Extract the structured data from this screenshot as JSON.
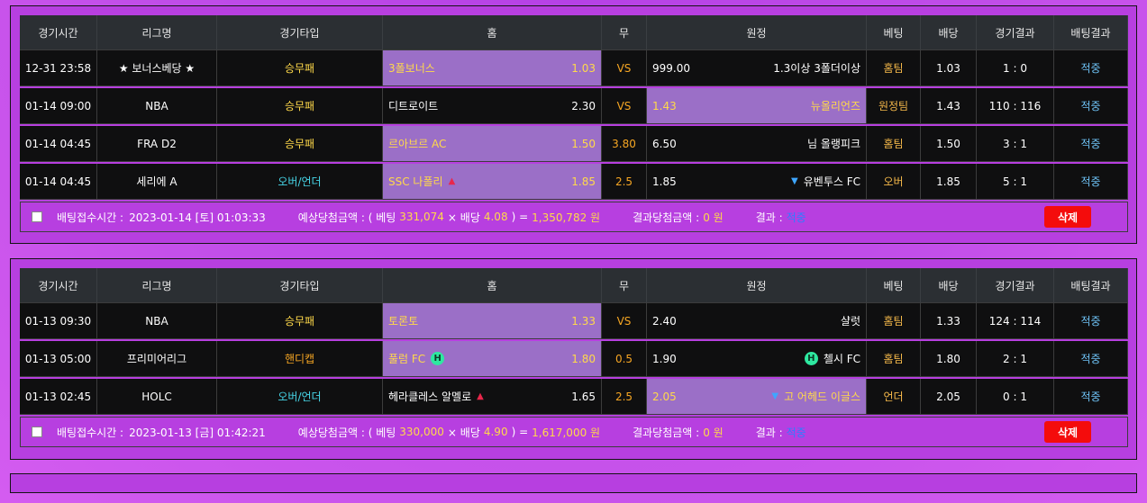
{
  "headers": [
    "경기시간",
    "리그명",
    "경기타입",
    "홈",
    "무",
    "원정",
    "베팅",
    "배당",
    "경기결과",
    "배팅결과"
  ],
  "slips": [
    {
      "rows": [
        {
          "time": "12-31 23:58",
          "league": "★ 보너스베당 ★",
          "type": "승무패",
          "type_color": "yellow",
          "home": "3폴보너스",
          "home_odds": "1.03",
          "home_sel": true,
          "home_badge": "",
          "draw": "VS",
          "draw_color": "orange",
          "away_odds": "999.00",
          "away": "1.3이상 3폴더이상",
          "away_sel": false,
          "away_badge": "",
          "bet": "홈팀",
          "odds": "1.03",
          "result": "1 : 0",
          "bet_result": "적중"
        },
        {
          "time": "01-14 09:00",
          "league": "NBA",
          "type": "승무패",
          "type_color": "yellow",
          "home": "디트로이트",
          "home_odds": "2.30",
          "home_sel": false,
          "home_badge": "",
          "draw": "VS",
          "draw_color": "orange",
          "away_odds": "1.43",
          "away": "뉴올리언즈",
          "away_sel": true,
          "away_badge": "",
          "bet": "원정팀",
          "odds": "1.43",
          "result": "110 : 116",
          "bet_result": "적중"
        },
        {
          "time": "01-14 04:45",
          "league": "FRA D2",
          "type": "승무패",
          "type_color": "yellow",
          "home": "르아브르 AC",
          "home_odds": "1.50",
          "home_sel": true,
          "home_badge": "",
          "draw": "3.80",
          "draw_color": "orange",
          "away_odds": "6.50",
          "away": "님 올랭피크",
          "away_sel": false,
          "away_badge": "",
          "bet": "홈팀",
          "odds": "1.50",
          "result": "3 : 1",
          "bet_result": "적중"
        },
        {
          "time": "01-14 04:45",
          "league": "세리에 A",
          "type": "오버/언더",
          "type_color": "cyan",
          "home": "SSC 나폴리",
          "home_odds": "1.85",
          "home_sel": true,
          "home_badge": "up",
          "draw": "2.5",
          "draw_color": "orange",
          "away_odds": "1.85",
          "away": "유벤투스 FC",
          "away_sel": false,
          "away_badge": "down",
          "bet": "오버",
          "odds": "1.85",
          "result": "5 : 1",
          "bet_result": "적중"
        }
      ],
      "summary": {
        "time_label": "배팅접수시간 :",
        "time_value": "2023-01-14 [토] 01:03:33",
        "expected_label": "예상당첨금액 : ( 베팅",
        "bet_amount": "331,074",
        "times": "× 배당",
        "total_odds": "4.08",
        "eq": ") =",
        "expected_value": "1,350,782 원",
        "win_label": "결과당첨금액 :",
        "win_value": "0 원",
        "result_label": "결과 :",
        "result_value": "적중",
        "delete_label": "삭제"
      }
    },
    {
      "rows": [
        {
          "time": "01-13 09:30",
          "league": "NBA",
          "type": "승무패",
          "type_color": "yellow",
          "home": "토론토",
          "home_odds": "1.33",
          "home_sel": true,
          "home_badge": "",
          "draw": "VS",
          "draw_color": "orange",
          "away_odds": "2.40",
          "away": "샬럿",
          "away_sel": false,
          "away_badge": "",
          "bet": "홈팀",
          "odds": "1.33",
          "result": "124 : 114",
          "bet_result": "적중"
        },
        {
          "time": "01-13 05:00",
          "league": "프리미어리그",
          "type": "핸디캡",
          "type_color": "orange",
          "home": "풀럼 FC",
          "home_odds": "1.80",
          "home_sel": true,
          "home_badge": "H",
          "draw": "0.5",
          "draw_color": "orange",
          "away_odds": "1.90",
          "away": "첼시 FC",
          "away_sel": false,
          "away_badge": "H",
          "bet": "홈팀",
          "odds": "1.80",
          "result": "2 : 1",
          "bet_result": "적중"
        },
        {
          "time": "01-13 02:45",
          "league": "HOLC",
          "type": "오버/언더",
          "type_color": "cyan",
          "home": "헤라클레스 알멜로",
          "home_odds": "1.65",
          "home_sel": false,
          "home_badge": "up",
          "draw": "2.5",
          "draw_color": "orange",
          "away_odds": "2.05",
          "away": "고 어헤드 이글스",
          "away_sel": true,
          "away_badge": "down",
          "bet": "언더",
          "odds": "2.05",
          "result": "0 : 1",
          "bet_result": "적중"
        }
      ],
      "summary": {
        "time_label": "배팅접수시간 :",
        "time_value": "2023-01-13 [금] 01:42:21",
        "expected_label": "예상당첨금액 : ( 베팅",
        "bet_amount": "330,000",
        "times": "× 배당",
        "total_odds": "4.90",
        "eq": ") =",
        "expected_value": "1,617,000 원",
        "win_label": "결과당첨금액 :",
        "win_value": "0 원",
        "result_label": "결과 :",
        "result_value": "적중",
        "delete_label": "삭제"
      }
    }
  ],
  "colors": {
    "accent": "#b73fe0",
    "selected": "#9b6fc7",
    "delete": "#f40c0c",
    "gold": "#ffd94a",
    "orange": "#f6a623",
    "cyan": "#47d6e8"
  }
}
